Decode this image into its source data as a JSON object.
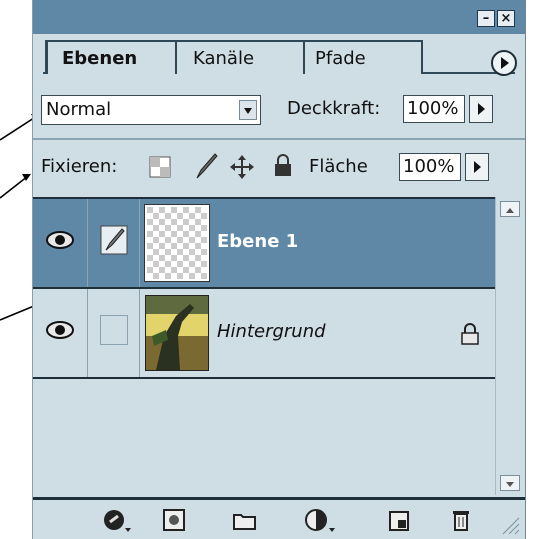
{
  "window": {
    "minimize_label": "–",
    "close_label": "×"
  },
  "tabs": [
    {
      "label": "Ebenen",
      "active": true
    },
    {
      "label": "Kanäle",
      "active": false
    },
    {
      "label": "Pfade",
      "active": false
    }
  ],
  "blend": {
    "mode": "Normal",
    "opacity_label": "Deckkraft:",
    "opacity_value": "100%"
  },
  "lock": {
    "label": "Fixieren:",
    "fill_label": "Fläche",
    "fill_value": "100%"
  },
  "layers": [
    {
      "name": "Ebene 1",
      "selected": true,
      "visible": true,
      "brush": true
    },
    {
      "name": "Hintergrund",
      "selected": false,
      "visible": true,
      "locked": true
    }
  ],
  "footer_icons": [
    "layer-style-icon",
    "mask-icon",
    "new-set-icon",
    "adjustment-layer-icon",
    "new-layer-icon",
    "trash-icon"
  ],
  "colors": {
    "titlebar": "#5e88a5",
    "panel": "#cfdde5",
    "selected_row": "#5e88a5"
  }
}
